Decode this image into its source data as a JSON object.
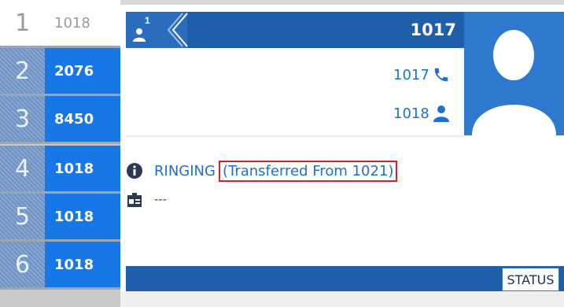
{
  "line_keys": [
    {
      "index": "1",
      "label": "1018",
      "selected": true
    },
    {
      "index": "2",
      "label": "2076",
      "selected": false
    },
    {
      "index": "3",
      "label": "8450",
      "selected": false
    },
    {
      "index": "4",
      "label": "1018",
      "selected": false
    },
    {
      "index": "5",
      "label": "1018",
      "selected": false
    },
    {
      "index": "6",
      "label": "1018",
      "selected": false
    }
  ],
  "call": {
    "header_number": "1017",
    "call_index": "1",
    "remote_number": "1017",
    "local_number": "1018",
    "status": "RINGING",
    "transfer_info": "(Transferred From 1021)",
    "placeholder": "---"
  },
  "softkeys": {
    "status_label": "STATUS"
  },
  "icons": {
    "avatar": "avatar-silhouette-icon",
    "phone": "phone-icon",
    "user": "user-icon",
    "info": "info-icon",
    "badge": "contact-card-icon",
    "chevrons": "chevron-left-icon"
  },
  "colors": {
    "accent_blue": "#1777e6",
    "header_blue": "#1f5ea8",
    "text_blue": "#1d6fd0",
    "highlight_red": "#e02020"
  }
}
